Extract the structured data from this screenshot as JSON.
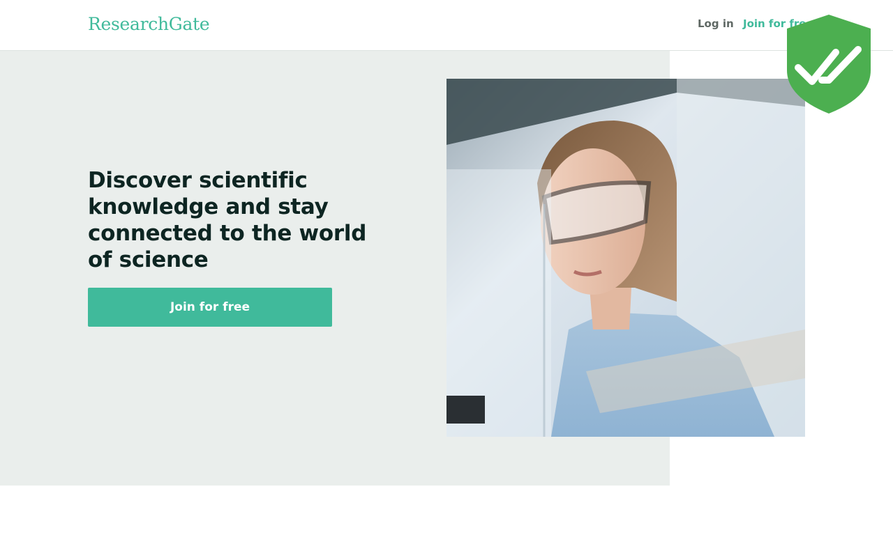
{
  "header": {
    "logo": "ResearchGate",
    "login_label": "Log in",
    "join_label": "Join for free"
  },
  "hero": {
    "headline": "Discover scientific knowledge and stay connected to the world of science",
    "cta_label": "Join for free",
    "background_color": "#eaeeec",
    "accent_color": "#40ba9b",
    "image": "scientist-with-safety-goggles-photo"
  },
  "overlay": {
    "icon": "shield-check-icon",
    "color": "#4caf50"
  }
}
